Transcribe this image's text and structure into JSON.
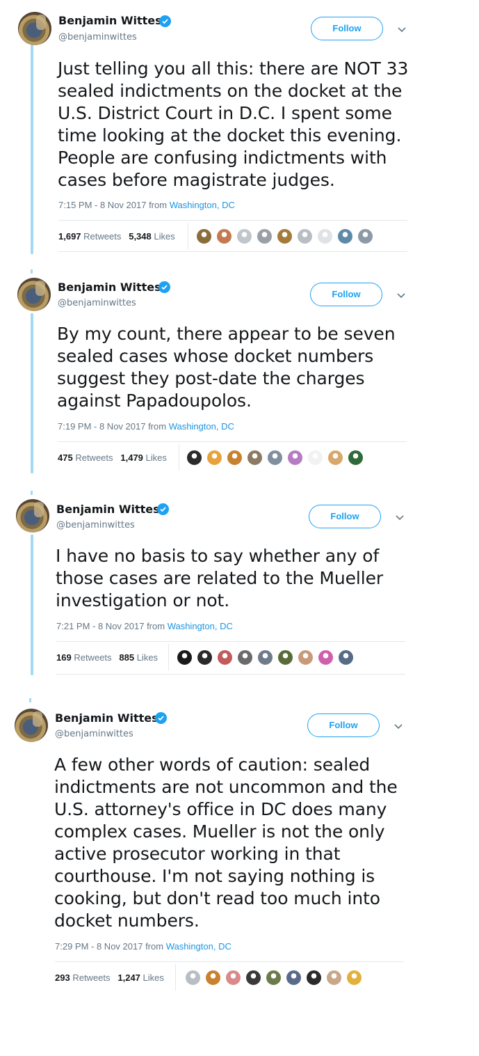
{
  "tweets": [
    {
      "name": "Benjamin Wittes",
      "handle": "@benjaminwittes",
      "follow_label": "Follow",
      "text": "Just telling you all this: there are NOT 33\nsealed indictments on the docket at the\nU.S. District Court in D.C. I spent some\ntime looking at the docket this evening.\nPeople are confusing indictments with\ncases before magistrate judges.",
      "timestamp": "7:15 PM - 8 Nov 2017 from ",
      "location": "Washington, DC",
      "retweets_count": "1,697",
      "retweets_label": "Retweets",
      "likes_count": "5,348",
      "likes_label": "Likes",
      "liker_colors": [
        "#8a6d3b",
        "#c47a50",
        "#c0c6cc",
        "#9aa0a6",
        "#a47b3a",
        "#b8bec4",
        "#dfe3e6",
        "#5d8aa8",
        "#8c9aa8"
      ]
    },
    {
      "name": "Benjamin Wittes",
      "handle": "@benjaminwittes",
      "follow_label": "Follow",
      "text": "By my count, there appear to be seven\nsealed cases whose docket numbers\nsuggest they post-date the charges\nagainst Papadoupolos.",
      "timestamp": "7:19 PM - 8 Nov 2017 from ",
      "location": "Washington, DC",
      "retweets_count": "475",
      "retweets_label": "Retweets",
      "likes_count": "1,479",
      "likes_label": "Likes",
      "liker_colors": [
        "#2b2b2b",
        "#e7a23c",
        "#c9812f",
        "#8c7a62",
        "#7f8f9f",
        "#b67cc2",
        "#f2f2f2",
        "#d8a86a",
        "#2f6b3a"
      ]
    },
    {
      "name": "Benjamin Wittes",
      "handle": "@benjaminwittes",
      "follow_label": "Follow",
      "text": "I have no basis to say whether any of\nthose cases are related to the Mueller\ninvestigation or not.",
      "timestamp": "7:21 PM - 8 Nov 2017 from ",
      "location": "Washington, DC",
      "retweets_count": "169",
      "retweets_label": "Retweets",
      "likes_count": "885",
      "likes_label": "Likes",
      "liker_colors": [
        "#1a1a1a",
        "#2a2a2a",
        "#c25b5b",
        "#6b6b6b",
        "#6e7c8a",
        "#5a6b3a",
        "#c89a7a",
        "#d05fae",
        "#556b86"
      ]
    },
    {
      "name": "Benjamin Wittes",
      "handle": "@benjaminwittes",
      "follow_label": "Follow",
      "text": "A few other words of caution: sealed\nindictments are not uncommon and the\nU.S. attorney's office in DC does many\ncomplex cases. Mueller is not the only\nactive prosecutor working in that\ncourthouse. I'm not saying nothing is\ncooking, but don't read too much into\ndocket numbers.",
      "timestamp": "7:29 PM - 8 Nov 2017 from ",
      "location": "Washington, DC",
      "retweets_count": "293",
      "retweets_label": "Retweets",
      "likes_count": "1,247",
      "likes_label": "Likes",
      "liker_colors": [
        "#b8bec4",
        "#c9812f",
        "#d98a8a",
        "#3a3a3a",
        "#6b7b4a",
        "#5a6a8a",
        "#2b2b2b",
        "#c9a88a",
        "#e2b13c"
      ]
    }
  ]
}
